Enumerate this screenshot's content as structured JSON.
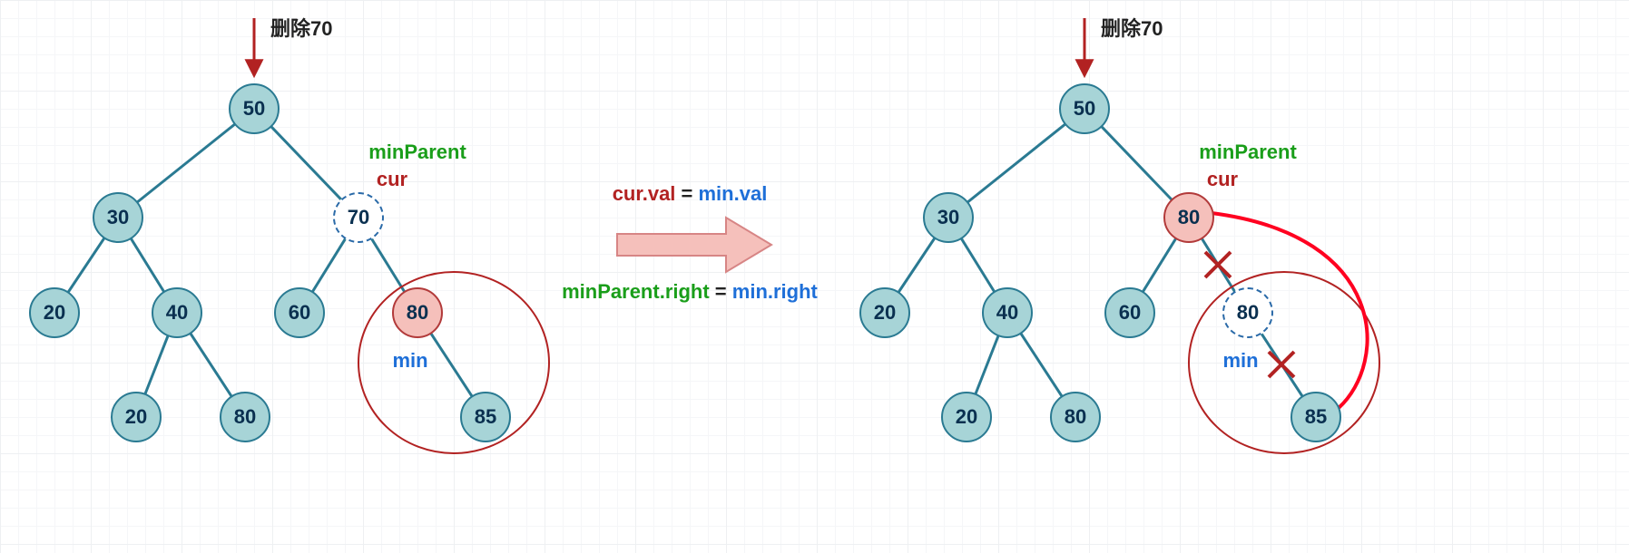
{
  "chart_data": [
    {
      "type": "tree-diagram",
      "title": "删除70 (before)",
      "nodes": [
        {
          "id": "n50",
          "value": 50,
          "style": "normal"
        },
        {
          "id": "n30",
          "value": 30,
          "style": "normal"
        },
        {
          "id": "n70",
          "value": 70,
          "style": "dashed",
          "annotations": [
            "minParent",
            "cur"
          ]
        },
        {
          "id": "n20",
          "value": 20,
          "style": "normal"
        },
        {
          "id": "n40",
          "value": 40,
          "style": "normal"
        },
        {
          "id": "n60",
          "value": 60,
          "style": "normal"
        },
        {
          "id": "n80",
          "value": 80,
          "style": "pink",
          "annotations": [
            "min"
          ]
        },
        {
          "id": "n20b",
          "value": 20,
          "style": "normal"
        },
        {
          "id": "n80b",
          "value": 80,
          "style": "normal"
        },
        {
          "id": "n85",
          "value": 85,
          "style": "normal"
        }
      ],
      "edges": [
        [
          "n50",
          "n30"
        ],
        [
          "n50",
          "n70"
        ],
        [
          "n30",
          "n20"
        ],
        [
          "n30",
          "n40"
        ],
        [
          "n70",
          "n60"
        ],
        [
          "n70",
          "n80"
        ],
        [
          "n40",
          "n20b"
        ],
        [
          "n40",
          "n80b"
        ],
        [
          "n80",
          "n85"
        ]
      ],
      "subtree_circled_root": "n80"
    },
    {
      "type": "tree-diagram",
      "title": "删除70 (after)",
      "nodes": [
        {
          "id": "m50",
          "value": 50,
          "style": "normal"
        },
        {
          "id": "m30",
          "value": 30,
          "style": "normal"
        },
        {
          "id": "m80top",
          "value": 80,
          "style": "pink",
          "annotations": [
            "minParent",
            "cur"
          ]
        },
        {
          "id": "m20",
          "value": 20,
          "style": "normal"
        },
        {
          "id": "m40",
          "value": 40,
          "style": "normal"
        },
        {
          "id": "m60",
          "value": 60,
          "style": "normal"
        },
        {
          "id": "m80old",
          "value": 80,
          "style": "dashed",
          "annotations": [
            "min"
          ]
        },
        {
          "id": "m20b",
          "value": 20,
          "style": "normal"
        },
        {
          "id": "m80b",
          "value": 80,
          "style": "normal"
        },
        {
          "id": "m85",
          "value": 85,
          "style": "normal"
        }
      ],
      "edges": [
        [
          "m50",
          "m30"
        ],
        [
          "m50",
          "m80top"
        ],
        [
          "m30",
          "m20"
        ],
        [
          "m30",
          "m40"
        ],
        [
          "m80top",
          "m60"
        ],
        [
          "m80top",
          "m80old",
          "removed"
        ],
        [
          "m40",
          "m20b"
        ],
        [
          "m40",
          "m80b"
        ],
        [
          "m80old",
          "m85",
          "removed"
        ],
        [
          "m80top",
          "m85",
          "new"
        ]
      ],
      "subtree_circled_root": "m80old"
    }
  ],
  "labels": {
    "delete_left": "删除70",
    "delete_right": "删除70",
    "minParent_left": "minParent",
    "cur_left": "cur",
    "min_left": "min",
    "minParent_right": "minParent",
    "cur_right": "cur",
    "min_right": "min",
    "eq_lhs": "cur.val",
    "eq_eq": " = ",
    "eq_rhs": "min.val",
    "eq2_lhs": "minParent.right",
    "eq2_eq": " = ",
    "eq2_rhs": "min.right"
  },
  "nodes": {
    "left": {
      "n50": "50",
      "n30": "30",
      "n70": "70",
      "n20": "20",
      "n40": "40",
      "n60": "60",
      "n80": "80",
      "n20b": "20",
      "n80b": "80",
      "n85": "85"
    },
    "right": {
      "m50": "50",
      "m30": "30",
      "m80top": "80",
      "m20": "20",
      "m40": "40",
      "m60": "60",
      "m80old": "80",
      "m20b": "20",
      "m80b": "80",
      "m85": "85"
    }
  },
  "colors": {
    "node_fill": "#a7d4d7",
    "node_stroke": "#2a7a92",
    "pink_fill": "#f5c0bb",
    "pink_stroke": "#b23a3a",
    "edge": "#2a7a92",
    "red": "#b22222",
    "green": "#1a9e1a",
    "blue": "#1e6fd8",
    "highlight_red": "#ff0020"
  }
}
